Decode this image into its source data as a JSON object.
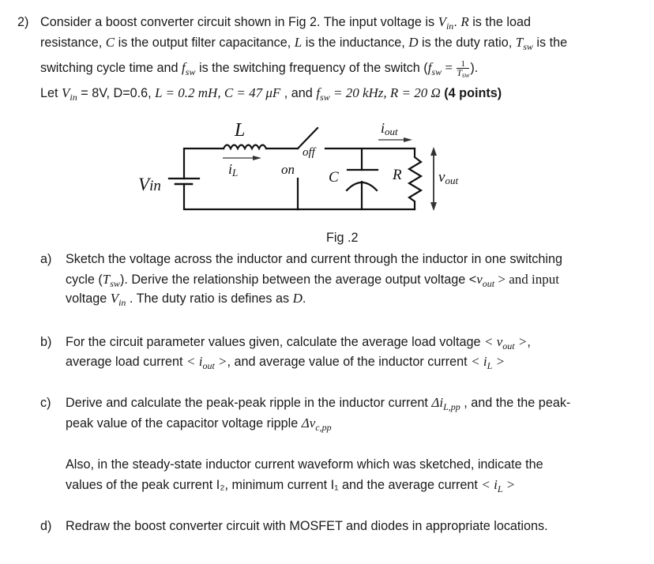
{
  "problem": {
    "number": "2)",
    "intro": {
      "line1": {
        "a": "Consider a boost converter circuit shown in Fig 2. The input voltage is ",
        "vin": "V",
        "vin_sub": "in",
        "b": ". ",
        "r": "R",
        "c": " is the load"
      },
      "line2": {
        "a": "resistance, ",
        "c": "C",
        "b": " is the output filter capacitance, ",
        "l": "L",
        "d": " is the inductance, ",
        "dd": "D",
        "e": " is the duty ratio, ",
        "t": "T",
        "t_sub": "sw",
        "f": " is the"
      },
      "line3": {
        "a": "switching cycle time and ",
        "f": "f",
        "f_sub": "sw",
        "b": " is the switching frequency of the switch (",
        "f2": "f",
        "f2_sub": "sw",
        "eq": " = ",
        "num": "1",
        "den": "T",
        "den_sub": "sw",
        "c": ")."
      },
      "line4": {
        "a": "Let ",
        "vin": "V",
        "vin_sub": "in",
        "b": " = 8V,   D=0.6, ",
        "l": "L = 0.2 mH, C = 47 μF",
        "c": " , and ",
        "f": "f",
        "f_sub": "sw",
        "fval": " = 20 kHz, R = 20 Ω",
        "points": " (4 points)"
      }
    }
  },
  "figure": {
    "labels": {
      "L": "L",
      "iout": "i",
      "iout_sub": "out",
      "off": "off",
      "iL": "i",
      "iL_sub": "L",
      "on": "on",
      "C": "C",
      "R": "R",
      "vout": "v",
      "vout_sub": "out",
      "vin": "V",
      "vin_sub": "in"
    },
    "caption": "Fig .2"
  },
  "parts": {
    "a": {
      "label": "a)",
      "l1": "Sketch the voltage across the inductor and current through the inductor in one switching",
      "l2a": "cycle (",
      "l2t": "T",
      "l2t_sub": "sw",
      "l2b": "). Derive the relationship between the average output voltage <",
      "l2v": "v",
      "l2v_sub": "out",
      "l2c": " >  and input",
      "l3a": "voltage ",
      "l3v": "V",
      "l3v_sub": "in",
      "l3b": " . The duty ratio is defines as ",
      "l3d": "D",
      "l3c": "."
    },
    "b": {
      "label": "b)",
      "l1a": "For the circuit parameter values given, calculate the average load voltage ",
      "l1v": "< v",
      "l1v_sub": "out",
      "l1c": " >",
      "l1d": ",",
      "l2a": "average load current ",
      "l2i": "< i",
      "l2i_sub": "out",
      "l2c": " >",
      "l2b": ", and average value of the inductor current ",
      "l2l": "< i",
      "l2l_sub": "L",
      "l2e": " >"
    },
    "c": {
      "label": "c)",
      "l1a": "Derive and calculate the peak-peak ripple in the inductor current  ",
      "l1d": "Δi",
      "l1d_sub": "L,pp",
      "l1b": " , and the  the peak-",
      "l2a": "peak value of the capacitor voltage ripple ",
      "l2d": "Δv",
      "l2d_sub": "c,pp"
    },
    "also": {
      "l1": "Also, in the steady-state  inductor current waveform which was sketched, indicate the",
      "l2a": "values of the peak current I₂, minimum current I₁ and the average current ",
      "l2l": "< i",
      "l2l_sub": "L",
      "l2c": " >"
    },
    "d": {
      "label": "d)",
      "l1": "Redraw the boost converter circuit with MOSFET and diodes in appropriate locations."
    }
  }
}
